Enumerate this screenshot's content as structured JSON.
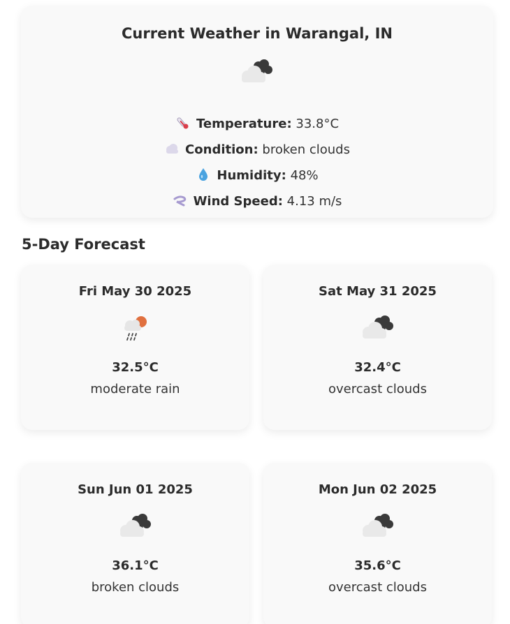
{
  "current": {
    "title": "Current Weather in Warangal, IN",
    "icon": "broken-clouds-icon",
    "rows": [
      {
        "icon": "thermometer-icon",
        "label": "Temperature:",
        "value": "33.8°C"
      },
      {
        "icon": "cloud-icon",
        "label": "Condition:",
        "value": "broken clouds"
      },
      {
        "icon": "droplet-icon",
        "label": "Humidity:",
        "value": "48%"
      },
      {
        "icon": "wind-icon",
        "label": "Wind Speed:",
        "value": "4.13 m/s"
      }
    ]
  },
  "forecast": {
    "heading": "5-Day Forecast",
    "days": [
      {
        "date": "Fri May 30 2025",
        "icon": "rain-sun-icon",
        "temp": "32.5°C",
        "desc": "moderate rain"
      },
      {
        "date": "Sat May 31 2025",
        "icon": "broken-clouds-icon",
        "temp": "32.4°C",
        "desc": "overcast clouds"
      },
      {
        "date": "Sun Jun 01 2025",
        "icon": "broken-clouds-icon",
        "temp": "36.1°C",
        "desc": "broken clouds"
      },
      {
        "date": "Mon Jun 02 2025",
        "icon": "broken-clouds-icon",
        "temp": "35.6°C",
        "desc": "overcast clouds"
      }
    ]
  }
}
